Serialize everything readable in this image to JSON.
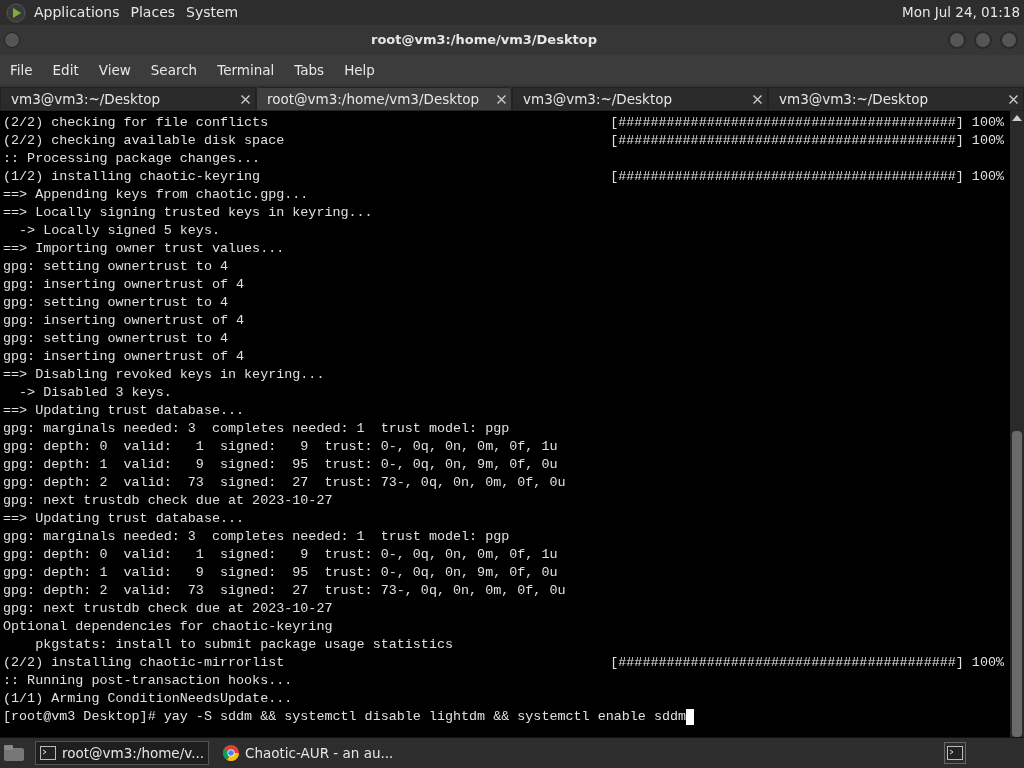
{
  "top_panel": {
    "menus": [
      "Applications",
      "Places",
      "System"
    ],
    "clock": "Mon Jul 24, 01:18"
  },
  "window": {
    "title": "root@vm3:/home/vm3/Desktop"
  },
  "menu_bar": [
    "File",
    "Edit",
    "View",
    "Search",
    "Terminal",
    "Tabs",
    "Help"
  ],
  "tabs": [
    {
      "label": "vm3@vm3:~/Desktop",
      "selected": false
    },
    {
      "label": "root@vm3:/home/vm3/Desktop",
      "selected": true
    },
    {
      "label": "vm3@vm3:~/Desktop",
      "selected": false
    },
    {
      "label": "vm3@vm3:~/Desktop",
      "selected": false
    }
  ],
  "terminal": {
    "lines": [
      {
        "text": "(2/2) checking for file conflicts",
        "progress": "[##########################################] 100%"
      },
      {
        "text": "(2/2) checking available disk space",
        "progress": "[##########################################] 100%"
      },
      {
        "text": ":: Processing package changes..."
      },
      {
        "text": "(1/2) installing chaotic-keyring",
        "progress": "[##########################################] 100%"
      },
      {
        "text": "==> Appending keys from chaotic.gpg..."
      },
      {
        "text": "==> Locally signing trusted keys in keyring..."
      },
      {
        "text": "  -> Locally signed 5 keys."
      },
      {
        "text": "==> Importing owner trust values..."
      },
      {
        "text": "gpg: setting ownertrust to 4"
      },
      {
        "text": "gpg: inserting ownertrust of 4"
      },
      {
        "text": "gpg: setting ownertrust to 4"
      },
      {
        "text": "gpg: inserting ownertrust of 4"
      },
      {
        "text": "gpg: setting ownertrust to 4"
      },
      {
        "text": "gpg: inserting ownertrust of 4"
      },
      {
        "text": "==> Disabling revoked keys in keyring..."
      },
      {
        "text": "  -> Disabled 3 keys."
      },
      {
        "text": "==> Updating trust database..."
      },
      {
        "text": "gpg: marginals needed: 3  completes needed: 1  trust model: pgp"
      },
      {
        "text": "gpg: depth: 0  valid:   1  signed:   9  trust: 0-, 0q, 0n, 0m, 0f, 1u"
      },
      {
        "text": "gpg: depth: 1  valid:   9  signed:  95  trust: 0-, 0q, 0n, 9m, 0f, 0u"
      },
      {
        "text": "gpg: depth: 2  valid:  73  signed:  27  trust: 73-, 0q, 0n, 0m, 0f, 0u"
      },
      {
        "text": "gpg: next trustdb check due at 2023-10-27"
      },
      {
        "text": "==> Updating trust database..."
      },
      {
        "text": "gpg: marginals needed: 3  completes needed: 1  trust model: pgp"
      },
      {
        "text": "gpg: depth: 0  valid:   1  signed:   9  trust: 0-, 0q, 0n, 0m, 0f, 1u"
      },
      {
        "text": "gpg: depth: 1  valid:   9  signed:  95  trust: 0-, 0q, 0n, 9m, 0f, 0u"
      },
      {
        "text": "gpg: depth: 2  valid:  73  signed:  27  trust: 73-, 0q, 0n, 0m, 0f, 0u"
      },
      {
        "text": "gpg: next trustdb check due at 2023-10-27"
      },
      {
        "text": "Optional dependencies for chaotic-keyring"
      },
      {
        "text": "    pkgstats: install to submit package usage statistics"
      },
      {
        "text": "(2/2) installing chaotic-mirrorlist",
        "progress": "[##########################################] 100%"
      },
      {
        "text": ":: Running post-transaction hooks..."
      },
      {
        "text": "(1/1) Arming ConditionNeedsUpdate..."
      }
    ],
    "prompt": "[root@vm3 Desktop]# yay -S sddm && systemctl disable lightdm && systemctl enable sddm"
  },
  "taskbar": {
    "items": [
      {
        "label": "root@vm3:/home/v...",
        "kind": "terminal",
        "selected": true
      },
      {
        "label": "Chaotic-AUR - an au...",
        "kind": "browser",
        "selected": false
      }
    ]
  }
}
